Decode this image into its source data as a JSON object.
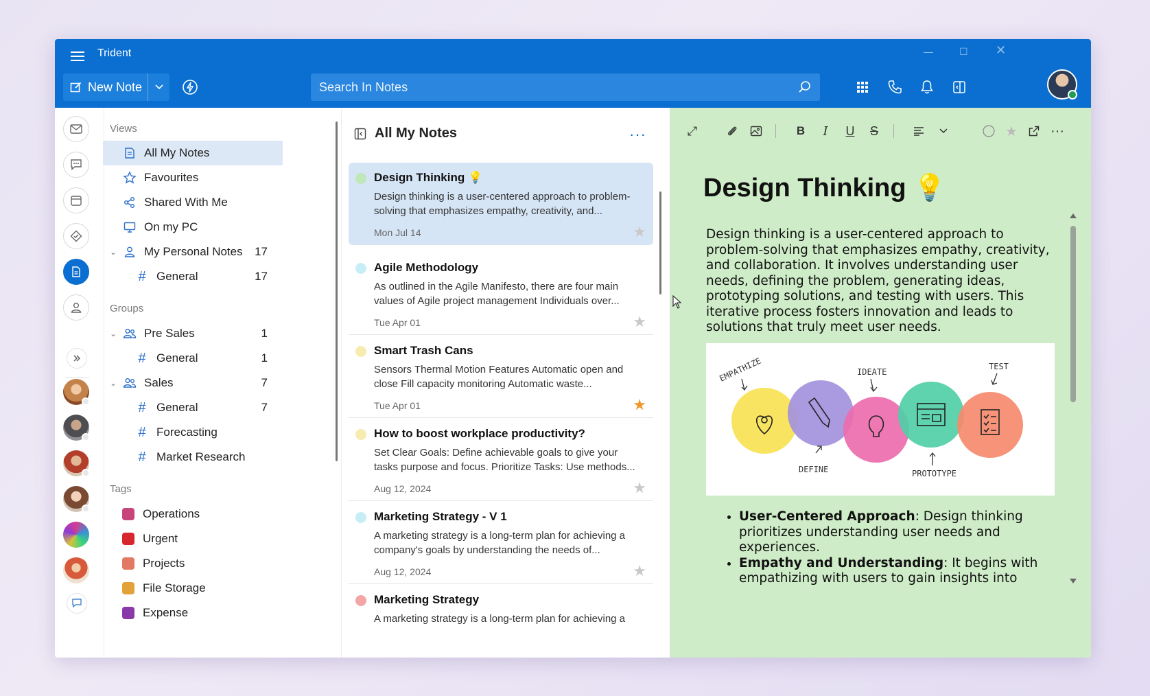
{
  "app": {
    "title": "Trident"
  },
  "header": {
    "new_note_label": "New Note",
    "search_placeholder": "Search In Notes"
  },
  "nav": {
    "views_label": "Views",
    "views": [
      {
        "label": "All My Notes",
        "icon": "notes-icon"
      },
      {
        "label": "Favourites",
        "icon": "star-icon"
      },
      {
        "label": "Shared With Me",
        "icon": "share-icon"
      },
      {
        "label": "On my PC",
        "icon": "monitor-icon"
      },
      {
        "label": "My Personal Notes",
        "icon": "person-icon",
        "count": "17"
      },
      {
        "label": "General",
        "count": "17"
      }
    ],
    "groups_label": "Groups",
    "groups": [
      {
        "label": "Pre Sales",
        "count": "1"
      },
      {
        "label": "General",
        "count": "1"
      },
      {
        "label": "Sales",
        "count": "7"
      },
      {
        "label": "General",
        "count": "7"
      },
      {
        "label": "Forecasting"
      },
      {
        "label": "Market Research"
      }
    ],
    "tags_label": "Tags",
    "tags": [
      {
        "label": "Operations",
        "color": "#c8457a"
      },
      {
        "label": "Urgent",
        "color": "#d8262e"
      },
      {
        "label": "Projects",
        "color": "#e27a63"
      },
      {
        "label": "File Storage",
        "color": "#e2a23a"
      },
      {
        "label": "Expense",
        "color": "#8a3aa8"
      }
    ]
  },
  "list": {
    "title": "All My Notes",
    "notes": [
      {
        "title": "Design Thinking 💡",
        "body": "Design thinking is a user-centered approach to problem-solving that emphasizes empathy, creativity, and...",
        "date": "Mon Jul 14",
        "dot": "#bfe8b8",
        "starred": false
      },
      {
        "title": "Agile Methodology",
        "body": "As outlined in the Agile Manifesto, there are four main values of Agile project management Individuals over...",
        "date": "Tue Apr 01",
        "dot": "#c7eef6",
        "starred": false
      },
      {
        "title": "Smart Trash Cans",
        "body": "Sensors Thermal Motion Features Automatic open and close Fill capacity monitoring Automatic waste...",
        "date": "Tue Apr 01",
        "dot": "#f6ecb0",
        "starred": true
      },
      {
        "title": "How to boost workplace productivity?",
        "body": "Set Clear Goals: Define achievable goals to give your tasks purpose and focus. Prioritize Tasks: Use methods...",
        "date": "Aug 12, 2024",
        "dot": "#f6ecb0",
        "starred": false
      },
      {
        "title": "Marketing Strategy - V 1",
        "body": "A marketing strategy is a long-term plan for achieving a company's goals by understanding the needs of...",
        "date": "Aug 12, 2024",
        "dot": "#c7eef6",
        "starred": false
      },
      {
        "title": "Marketing Strategy",
        "body": "A marketing strategy is a long-term plan for achieving a",
        "date": "",
        "dot": "#f4a5a5",
        "starred": false
      }
    ]
  },
  "editor": {
    "title": "Design Thinking  💡",
    "paragraph": "Design thinking is a user-centered approach to problem-solving that emphasizes empathy, creativity, and collaboration. It involves understanding user needs, defining the problem, generating ideas, prototyping solutions, and testing with users. This iterative process fosters innovation and leads to solutions that truly meet user needs.",
    "image_labels": {
      "empathize": "EMPATHIZE",
      "define": "DEFINE",
      "ideate": "IDEATE",
      "prototype": "PROTOTYPE",
      "test": "TEST"
    },
    "bullets": [
      {
        "bold": "User-Centered Approach",
        "text": ": Design thinking prioritizes understanding user needs and experiences."
      },
      {
        "bold": "Empathy and Understanding",
        "text": ": It begins with empathizing with users to gain insights into"
      }
    ]
  },
  "colors": {
    "brand": "#0a6fd0",
    "editor_bg": "#cfecc8",
    "selected": "#d6e5f5",
    "star_active": "#f0962a"
  }
}
